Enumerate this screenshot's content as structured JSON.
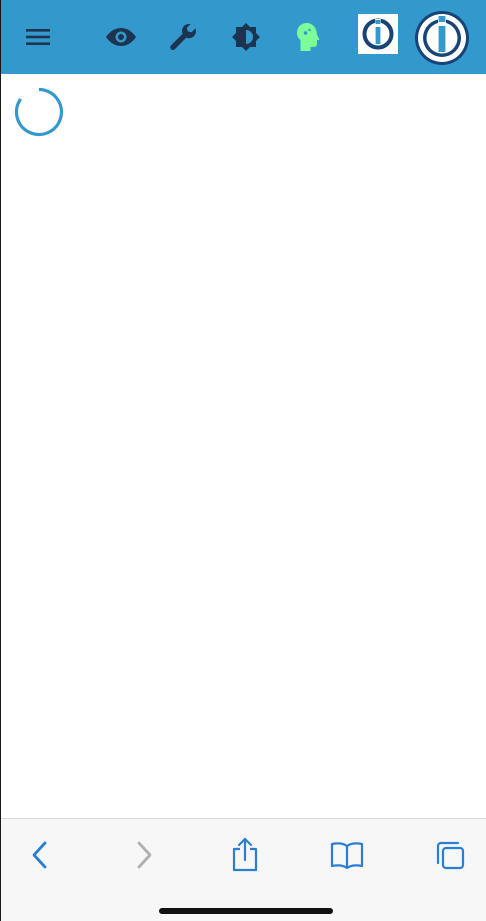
{
  "colors": {
    "appbar_bg": "#3399cc",
    "appbar_icon": "#1c3450",
    "active_icon": "#7bfd9b",
    "logo_blue": "#164477",
    "spinner": "#3399cc",
    "safari_icon_active": "#2a7fd4",
    "safari_icon_disabled": "#b0b0b0"
  },
  "appbar": {
    "icons": [
      "menu-icon",
      "eye-icon",
      "wrench-icon",
      "brightness-icon",
      "head-profile-icon"
    ],
    "logos": [
      "iobroker-square-logo",
      "iobroker-round-logo"
    ]
  },
  "content": {
    "state": "loading"
  },
  "safari_toolbar": {
    "icons": [
      "back-icon",
      "forward-icon",
      "share-icon",
      "bookmarks-icon",
      "tabs-icon"
    ],
    "forward_disabled": true
  }
}
